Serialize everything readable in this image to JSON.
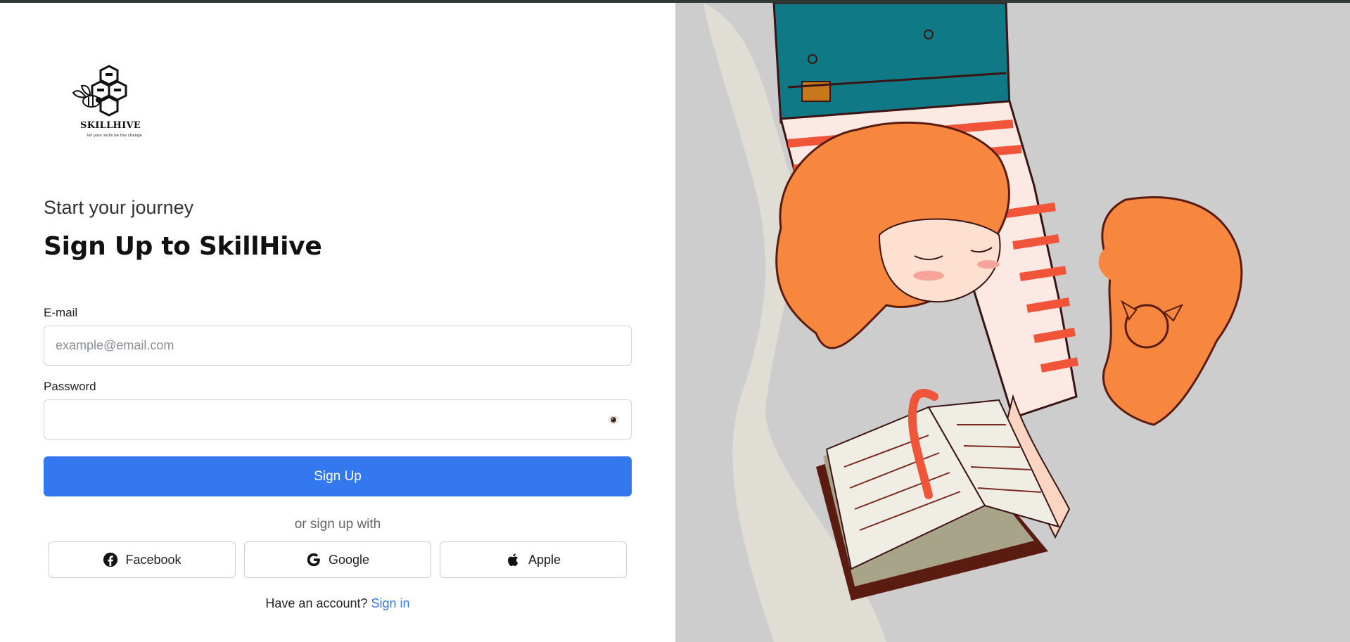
{
  "brand": {
    "name": "SKILLHIVE",
    "tagline": "let your skills be the change"
  },
  "hero": {
    "kicker": "Start your journey",
    "title": "Sign Up to SkillHive"
  },
  "form": {
    "email_label": "E-mail",
    "email_placeholder": "example@email.com",
    "email_value": "",
    "password_label": "Password",
    "password_value": "",
    "submit_label": "Sign Up",
    "divider_text": "or sign up with"
  },
  "social": [
    {
      "label": "Facebook",
      "icon": "facebook-icon"
    },
    {
      "label": "Google",
      "icon": "google-icon"
    },
    {
      "label": "Apple",
      "icon": "apple-icon"
    }
  ],
  "footer": {
    "prompt": "Have an account?",
    "link": "Sign in"
  },
  "colors": {
    "accent": "#3378ee",
    "illustration_bg": "#cdcdcd"
  }
}
